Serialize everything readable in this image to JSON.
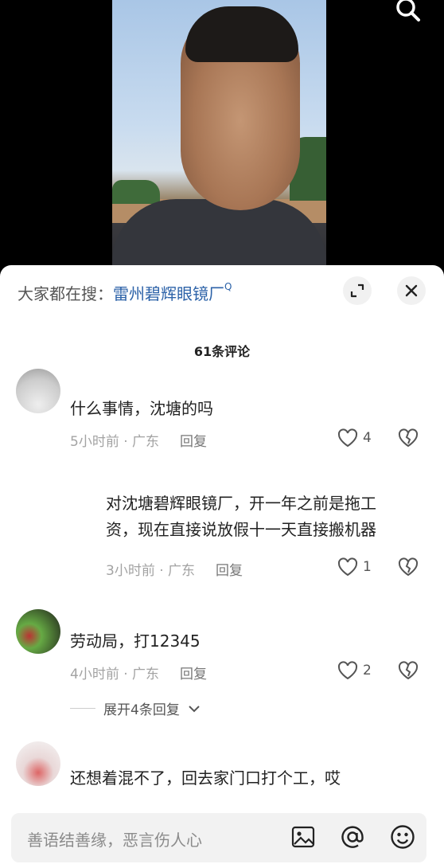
{
  "hot_search": {
    "prefix": "大家都在搜：",
    "keyword": "雷州碧辉眼镜厂",
    "search_glyph": "Q"
  },
  "comment_count": "61条评论",
  "comments": [
    {
      "text": "什么事情，沈塘的吗",
      "time": "5小时前 · 广东",
      "reply_label": "回复",
      "likes": "4"
    },
    {
      "text_line1": "对沈塘碧辉眼镜厂，开一年之前是拖工",
      "text_line2": "资，现在直接说放假十一天直接搬机器",
      "time": "3小时前 · 广东",
      "reply_label": "回复",
      "likes": "1"
    },
    {
      "text": "劳动局，打12345",
      "time": "4小时前 · 广东",
      "reply_label": "回复",
      "likes": "2",
      "expand_label": "展开4条回复"
    },
    {
      "text": "还想着混不了，回去家门口打个工，哎"
    }
  ],
  "input": {
    "placeholder": "善语结善缘，恶言伤人心"
  },
  "icons": [
    "search-icon",
    "expand-icon",
    "close-icon",
    "heart-icon",
    "broken-heart-icon",
    "image-icon",
    "at-icon",
    "emoji-icon",
    "chevron-down-icon"
  ],
  "colors": {
    "keyword": "#2c62a8",
    "meta": "#a3a3a3",
    "panel": "#ffffff"
  }
}
